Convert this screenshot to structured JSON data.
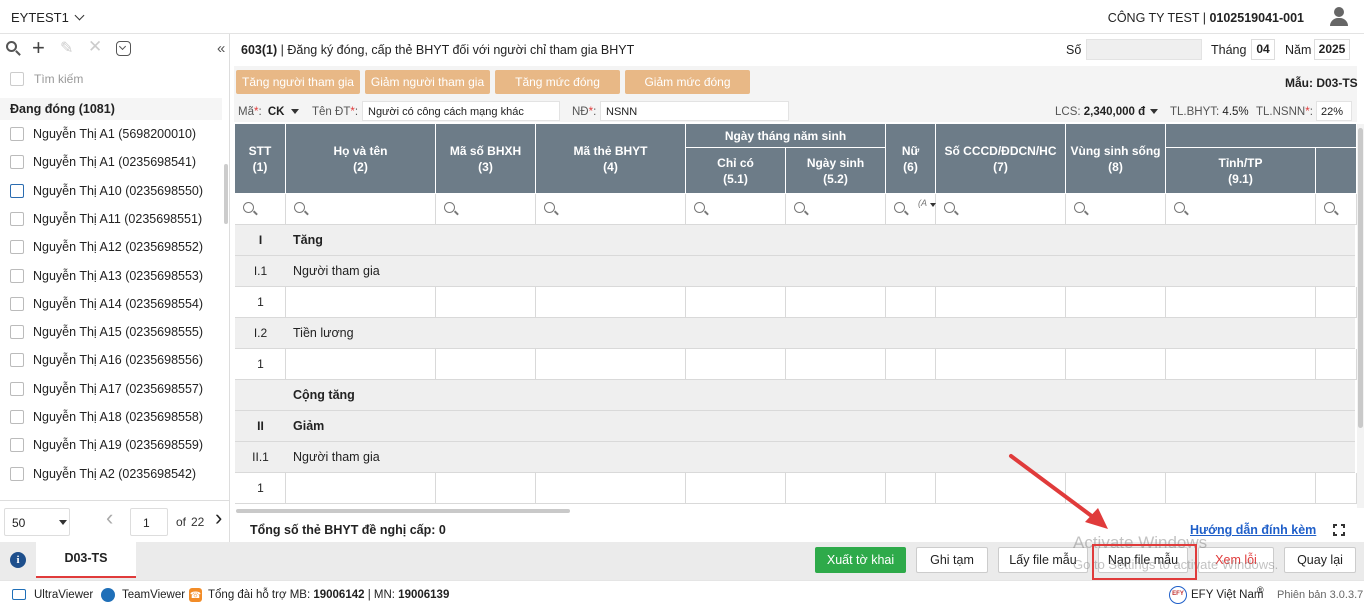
{
  "topbar": {
    "tenant": "EYTEST1",
    "company": "CÔNG TY TEST | ",
    "tax_code": "0102519041-001"
  },
  "sidebar": {
    "search_placeholder": "Tìm kiếm",
    "group_label": "Đang đóng (1081)",
    "items": [
      {
        "label": "Nguyễn Thị A1 (5698200010)"
      },
      {
        "label": "Nguyễn Thị A1 (0235698541)"
      },
      {
        "label": "Nguyễn Thị A10 (0235698550)"
      },
      {
        "label": "Nguyễn Thị A11 (0235698551)"
      },
      {
        "label": "Nguyễn Thị A12 (0235698552)"
      },
      {
        "label": "Nguyễn Thị A13 (0235698553)"
      },
      {
        "label": "Nguyễn Thị A14 (0235698554)"
      },
      {
        "label": "Nguyễn Thị A15 (0235698555)"
      },
      {
        "label": "Nguyễn Thị A16 (0235698556)"
      },
      {
        "label": "Nguyễn Thị A17 (0235698557)"
      },
      {
        "label": "Nguyễn Thị A18 (0235698558)"
      },
      {
        "label": "Nguyễn Thị A19 (0235698559)"
      },
      {
        "label": "Nguyễn Thị A2 (0235698542)"
      }
    ],
    "page_size": "50",
    "page": "1",
    "of_label": "of",
    "total_pages": "22"
  },
  "form": {
    "code": "603(1)",
    "title": " | Đăng ký đóng, cấp thẻ BHYT đối với người chỉ tham gia BHYT",
    "so_label": "Số",
    "so_value": "",
    "thang_label": "Tháng",
    "thang_value": "04",
    "nam_label": "Năm",
    "nam_value": "2025",
    "mau_label": "Mẫu: D03-TS"
  },
  "action_buttons": [
    "Tăng người tham gia",
    "Giảm người tham gia",
    "Tăng mức đóng",
    "Giảm mức đóng"
  ],
  "params": {
    "ma_label": "Mã",
    "ma_value": "CK",
    "tendt_label": "Tên ĐT",
    "tendt_value": "Người có công cách mạng khác",
    "nd_label": "NĐ",
    "nd_value": "NSNN",
    "lcs_label": "LCS:",
    "lcs_value": "2,340,000 đ",
    "tlbhyt_label": "TL.BHYT:",
    "tlbhyt_value": "4.5%",
    "tlnsnn_label": "TL.NSNN",
    "tlnsnn_value": "22%"
  },
  "table": {
    "headers": {
      "stt": [
        "STT",
        "(1)"
      ],
      "hoten": [
        "Họ và tên",
        "(2)"
      ],
      "masobhxh": [
        "Mã số BHXH",
        "(3)"
      ],
      "mathebhyt": [
        "Mã thẻ BHYT",
        "(4)"
      ],
      "ngaythang": "Ngày tháng năm sinh",
      "chico": [
        "Chỉ có",
        "(5.1)"
      ],
      "ngaysinh": [
        "Ngày sinh",
        "(5.2)"
      ],
      "nu": [
        "Nữ",
        "(6)"
      ],
      "cccd": [
        "Số CCCD/ĐDCN/HC",
        "(7)"
      ],
      "vungsong": [
        "Vùng sinh sống",
        "(8)"
      ],
      "tinhtp": [
        "Tỉnh/TP",
        "(9.1)"
      ]
    },
    "nu_filter": "(A",
    "rows": [
      {
        "stt": "I",
        "name": "Tăng",
        "type": "group"
      },
      {
        "stt": "I.1",
        "name": "Người tham gia",
        "type": "sub"
      },
      {
        "stt": "1",
        "name": "",
        "type": "data"
      },
      {
        "stt": "I.2",
        "name": "Tiền lương",
        "type": "sub"
      },
      {
        "stt": "1",
        "name": "",
        "type": "data"
      },
      {
        "stt": "",
        "name": "Cộng tăng",
        "type": "group"
      },
      {
        "stt": "II",
        "name": "Giảm",
        "type": "group"
      },
      {
        "stt": "II.1",
        "name": "Người tham gia",
        "type": "sub"
      },
      {
        "stt": "1",
        "name": "",
        "type": "data"
      }
    ],
    "footer_total": "Tổng số thẻ BHYT đề nghị cấp: 0",
    "guide_link": "Hướng dẫn đính kèm"
  },
  "tabs": {
    "active": "D03-TS"
  },
  "bottom_buttons": {
    "xuat": "Xuất tờ khai",
    "ghitam": "Ghi tạm",
    "layfile": "Lấy file mẫu",
    "napfile": "Nạp file mẫu",
    "xemloi": "Xem lỗi",
    "quaylai": "Quay lại"
  },
  "watermark": {
    "line1": "Activate Windows",
    "line2": "Go to Settings to activate Windows."
  },
  "statusbar": {
    "ultraviewer": "UltraViewer",
    "teamviewer": "TeamViewer",
    "hotline_prefix": "Tổng đài hỗ trợ MB: ",
    "hotline_mb": "19006142",
    "hotline_sep": " | MN: ",
    "hotline_mn": "19006139",
    "brand": "EFY Việt Nam",
    "version": "Phiên bản 3.0.3.7"
  },
  "colors": {
    "header_bg": "#6d7c88",
    "tan_button": "#e8b886",
    "green_button": "#2eaa4a",
    "annotation_red": "#e03b3b",
    "link_blue": "#1f5fc9"
  }
}
